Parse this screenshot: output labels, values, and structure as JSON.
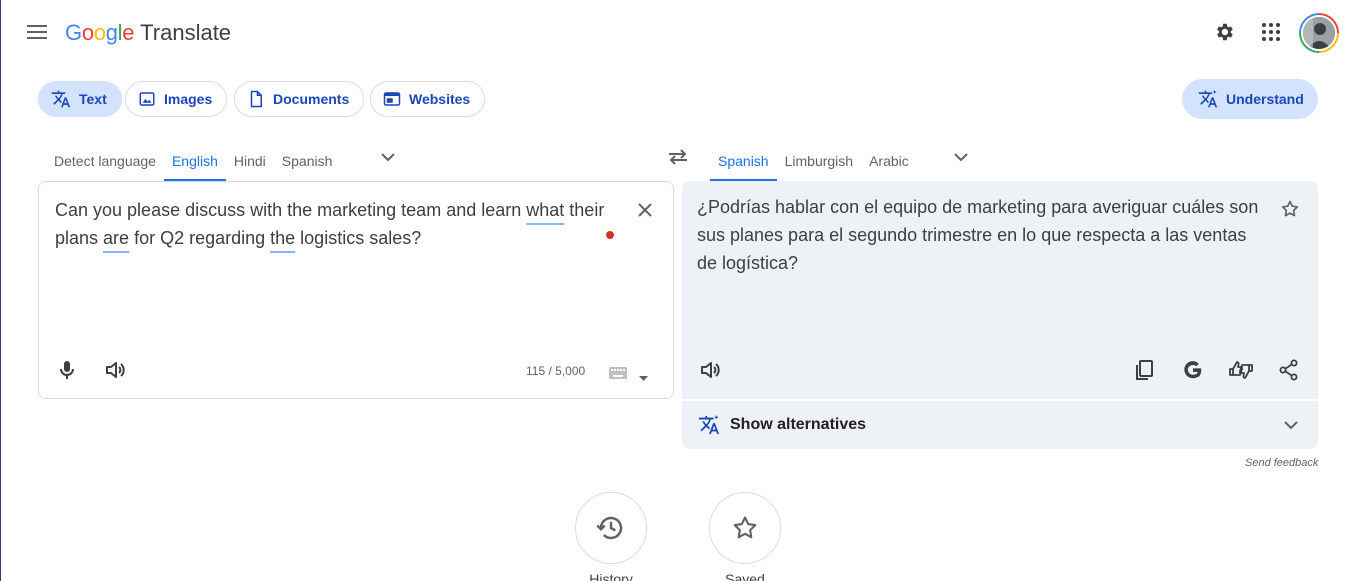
{
  "header": {
    "logo_letters": [
      "G",
      "o",
      "o",
      "g",
      "l",
      "e"
    ],
    "logo_colors": [
      "#4285f4",
      "#ea4335",
      "#fbbc04",
      "#4285f4",
      "#34a853",
      "#ea4335"
    ],
    "product_name": "Translate",
    "icons": [
      "menu-icon",
      "settings-gear-icon",
      "apps-grid-icon",
      "account-avatar"
    ]
  },
  "modes": {
    "items": [
      {
        "label": "Text",
        "icon": "translate-icon",
        "active": true
      },
      {
        "label": "Images",
        "icon": "image-icon",
        "active": false
      },
      {
        "label": "Documents",
        "icon": "document-icon",
        "active": false
      },
      {
        "label": "Websites",
        "icon": "website-icon",
        "active": false
      }
    ],
    "understand_label": "Understand"
  },
  "source": {
    "languages": [
      "Detect language",
      "English",
      "Hindi",
      "Spanish"
    ],
    "selected": "English",
    "text_parts": [
      "Can you please discuss with the marketing team and learn ",
      "what",
      " their plans ",
      "are",
      " for Q2 regarding ",
      "the",
      " logistics sales?"
    ],
    "char_count": "115 / 5,000"
  },
  "target": {
    "languages": [
      "Spanish",
      "Limburgish",
      "Arabic"
    ],
    "selected": "Spanish",
    "text": "¿Podrías hablar con el equipo de marketing para averiguar cuáles son sus planes para el segundo trimestre en lo que respecta a las ventas de logística?",
    "show_alternatives_label": "Show alternatives"
  },
  "feedback_label": "Send feedback",
  "bottom": {
    "history_label": "History",
    "saved_label": "Saved"
  },
  "colors": {
    "accent": "#1a73e8",
    "chip_active_bg": "#d3e3fd",
    "target_panel_bg": "#eef1f6",
    "spellcheck_underline": "#8ab4f8",
    "recording_dot": "#d93025"
  }
}
